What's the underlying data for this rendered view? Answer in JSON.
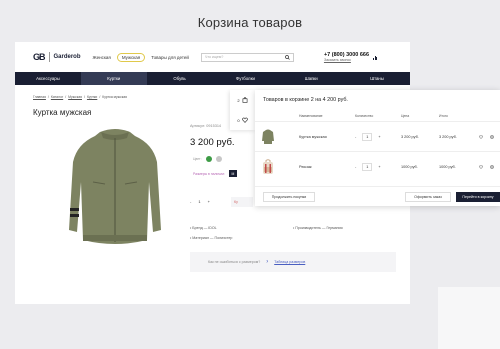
{
  "headline": "Корзина товаров",
  "header": {
    "logo_mark": "GB",
    "logo_text": "Garderob",
    "links": [
      "Женская",
      "Мужская",
      "Товары для детей"
    ],
    "search_placeholder": "Что ищем?",
    "phone": "+7 (800) 3000 666",
    "callback": "Заказать звонок"
  },
  "nav": [
    "Аксессуары",
    "Куртки",
    "Обувь",
    "Футболки",
    "Шапки",
    "Штаны"
  ],
  "breadcrumbs": [
    "Главная",
    "/",
    "Каталог",
    "/",
    "Мужская",
    "/",
    "Куртки",
    "/",
    "Куртка мужская"
  ],
  "product": {
    "title": "Куртка мужская",
    "article": "Артикул: 0915314",
    "price": "3 200 руб.",
    "color_label": "Цвет:",
    "size_label": "Размеры в наличии:",
    "size_value": "M",
    "qty": "1",
    "minus": "-",
    "plus": "+",
    "buy_label": "Ку",
    "props": [
      "Бренд — IDOL",
      "Материал — Полиэстер",
      "Производитель — Германия"
    ],
    "help_question": "Как не ошибиться с размером?",
    "help_link": "Таблица размеров"
  },
  "cart": {
    "side_counts": [
      "2",
      "0"
    ],
    "title": "Товаров в корзине 2 на 4 200 руб.",
    "columns": [
      "Наименование",
      "Количество",
      "Цена",
      "Итого"
    ],
    "items": [
      {
        "name": "Куртка мужская",
        "qty": "1",
        "price": "3 200 руб.",
        "total": "3 200 руб."
      },
      {
        "name": "Рюкзак",
        "qty": "1",
        "price": "1000 руб.",
        "total": "1000 руб."
      }
    ],
    "continue_label": "Продолжить покупки",
    "order_label": "Оформить заказ",
    "go_cart_label": "Перейти в корзину"
  },
  "colors": {
    "navy": "#1a1f33",
    "jacket": "#7d8361",
    "accent_yellow": "#e0c94b",
    "link_blue": "#4a5fc1"
  }
}
